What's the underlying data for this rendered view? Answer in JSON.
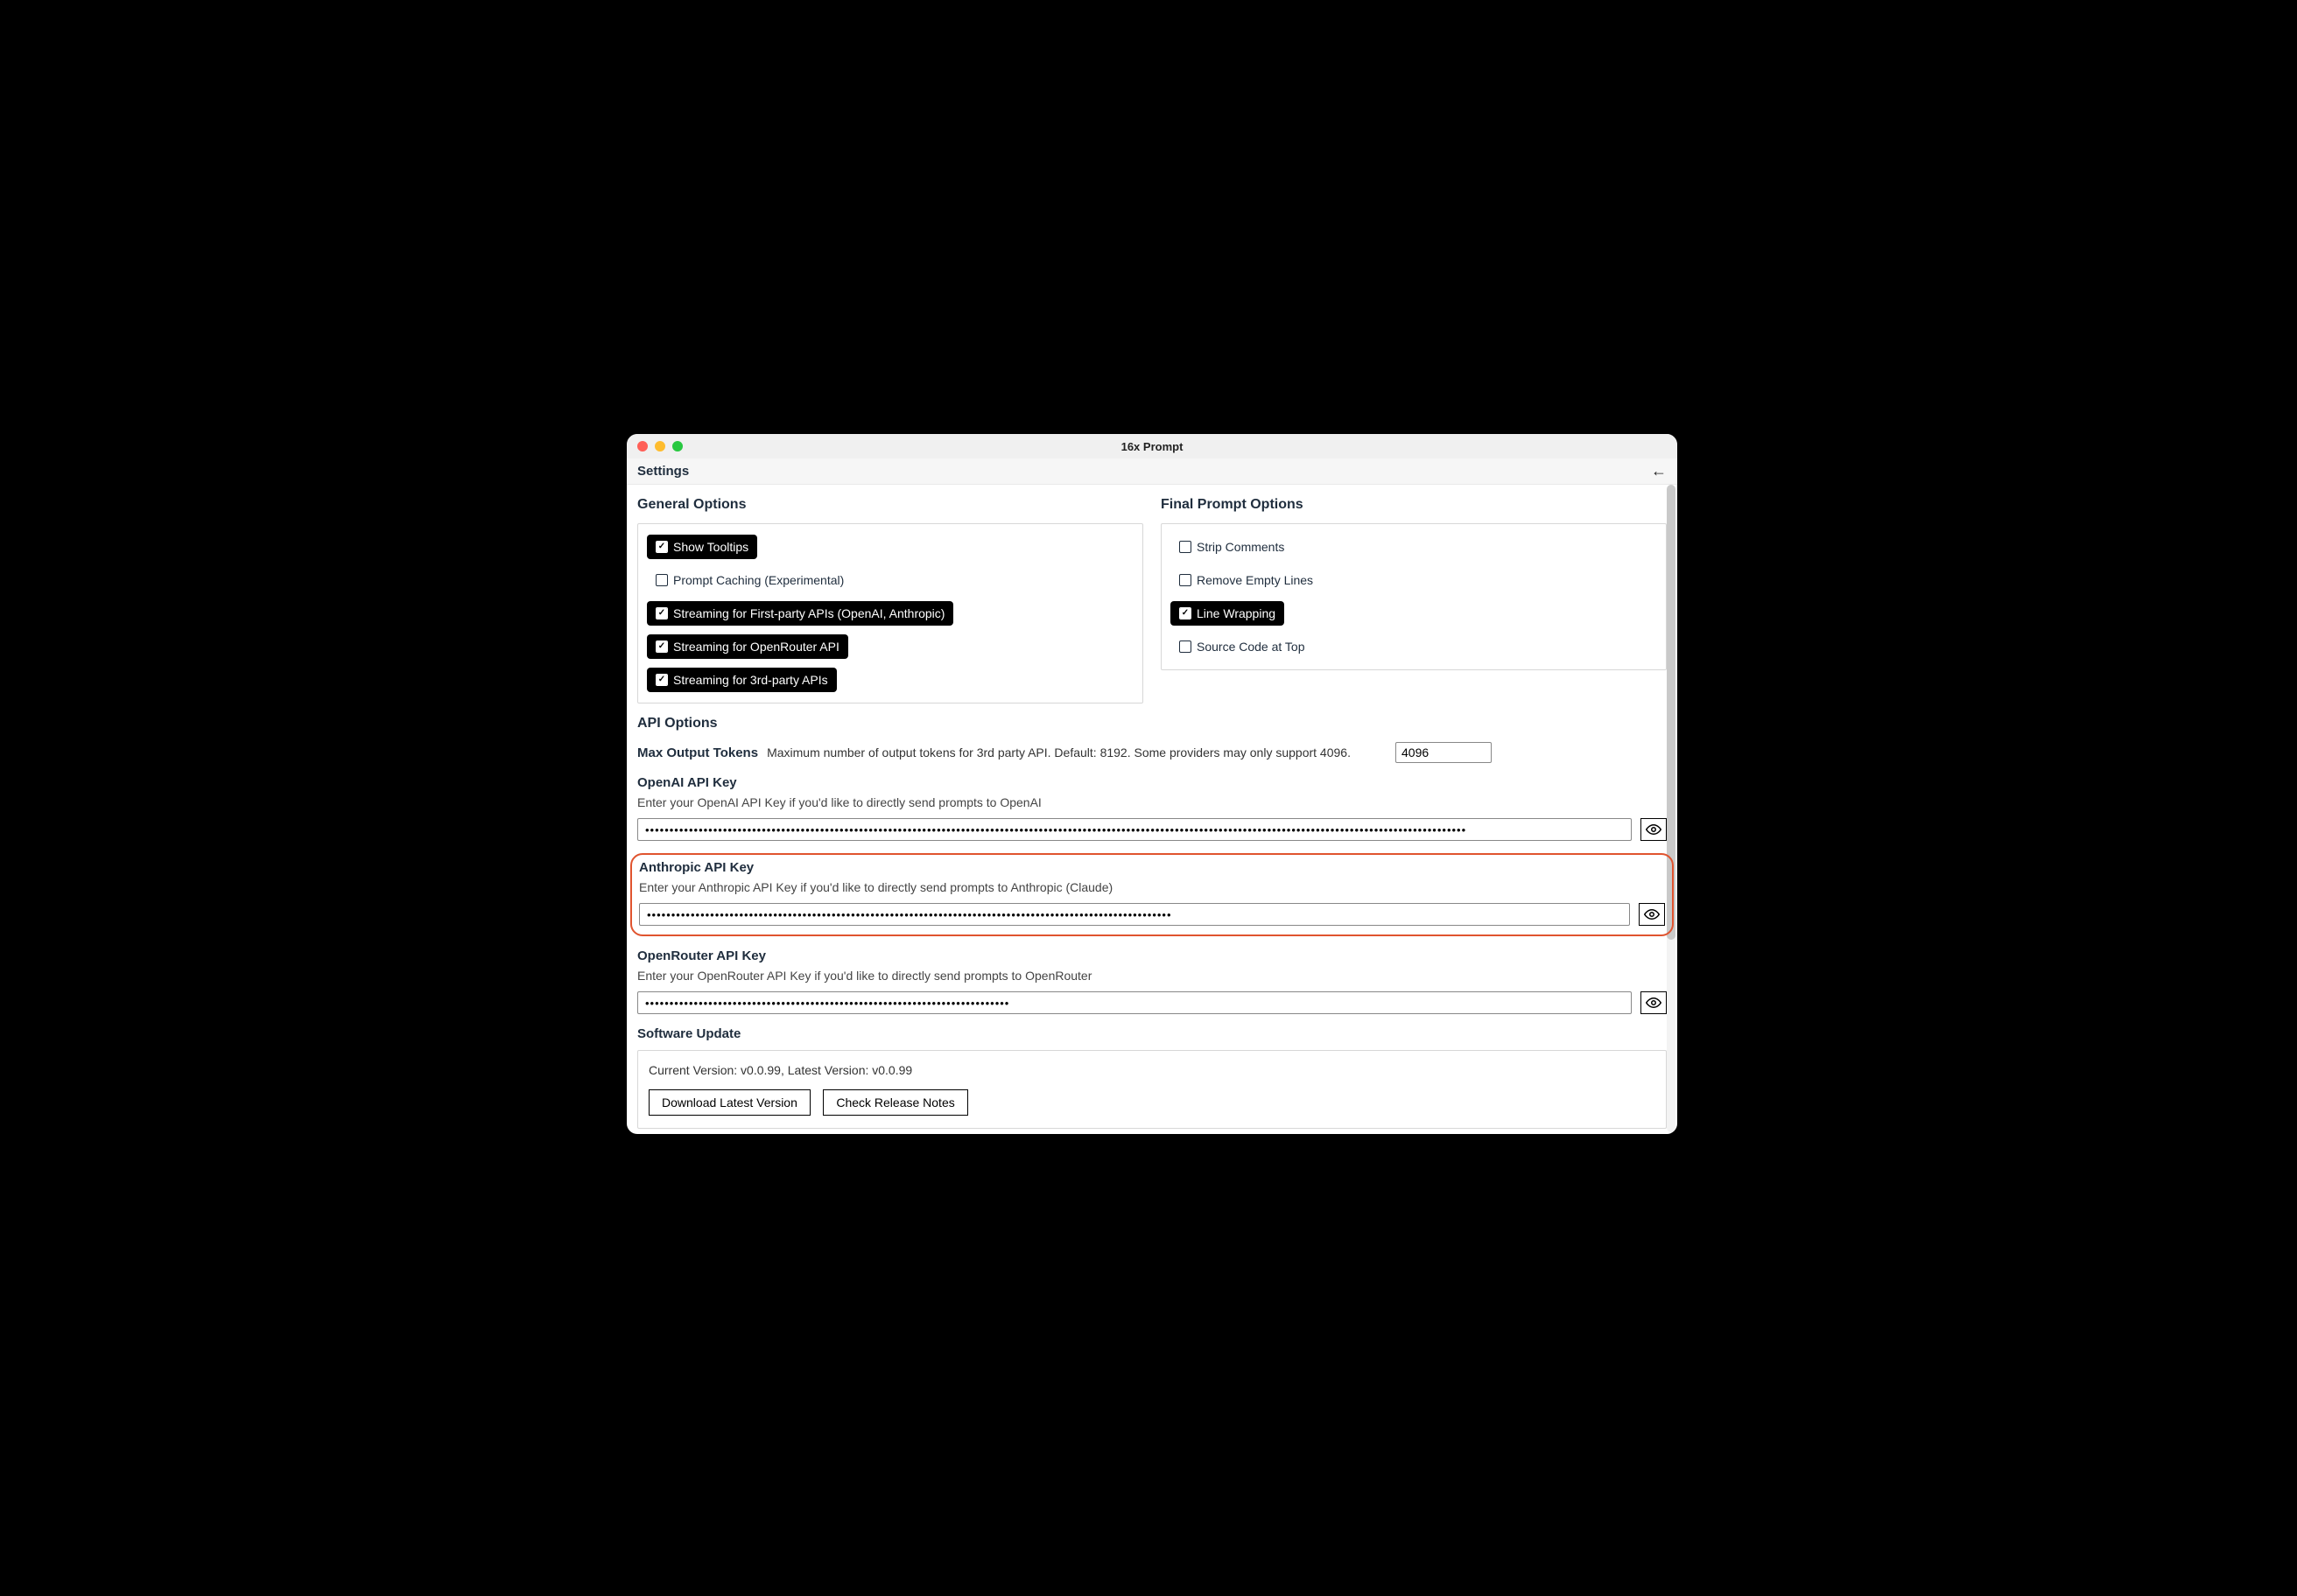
{
  "window": {
    "title": "16x Prompt"
  },
  "page": {
    "title": "Settings"
  },
  "general": {
    "heading": "General Options",
    "options": [
      {
        "label": "Show Tooltips",
        "checked": true
      },
      {
        "label": "Prompt Caching (Experimental)",
        "checked": false
      },
      {
        "label": "Streaming for First-party APIs (OpenAI, Anthropic)",
        "checked": true
      },
      {
        "label": "Streaming for OpenRouter API",
        "checked": true
      },
      {
        "label": "Streaming for 3rd-party APIs",
        "checked": true
      }
    ]
  },
  "finalPrompt": {
    "heading": "Final Prompt Options",
    "options": [
      {
        "label": "Strip Comments",
        "checked": false
      },
      {
        "label": "Remove Empty Lines",
        "checked": false
      },
      {
        "label": "Line Wrapping",
        "checked": true
      },
      {
        "label": "Source Code at Top",
        "checked": false
      }
    ]
  },
  "api": {
    "heading": "API Options",
    "maxTokens": {
      "label": "Max Output Tokens",
      "desc": "Maximum number of output tokens for 3rd party API. Default: 8192. Some providers may only support 4096.",
      "value": "4096"
    },
    "openai": {
      "label": "OpenAI API Key",
      "hint": "Enter your OpenAI API Key if you'd like to directly send prompts to OpenAI",
      "value": "•••••••••••••••••••••••••••••••••••••••••••••••••••••••••••••••••••••••••••••••••••••••••••••••••••••••••••••••••••••••••••••••••••••••••••••••••••••••••••••••••••••••••"
    },
    "anthropic": {
      "label": "Anthropic API Key",
      "hint": "Enter your Anthropic API Key if you'd like to directly send prompts to Anthropic (Claude)",
      "value": "••••••••••••••••••••••••••••••••••••••••••••••••••••••••••••••••••••••••••••••••••••••••••••••••••••••••••••"
    },
    "openrouter": {
      "label": "OpenRouter API Key",
      "hint": "Enter your OpenRouter API Key if you'd like to directly send prompts to OpenRouter",
      "value": "•••••••••••••••••••••••••••••••••••••••••••••••••••••••••••••••••••••••••••"
    }
  },
  "update": {
    "heading": "Software Update",
    "status": "Current Version: v0.0.99, Latest Version: v0.0.99",
    "downloadBtn": "Download Latest Version",
    "notesBtn": "Check Release Notes"
  }
}
